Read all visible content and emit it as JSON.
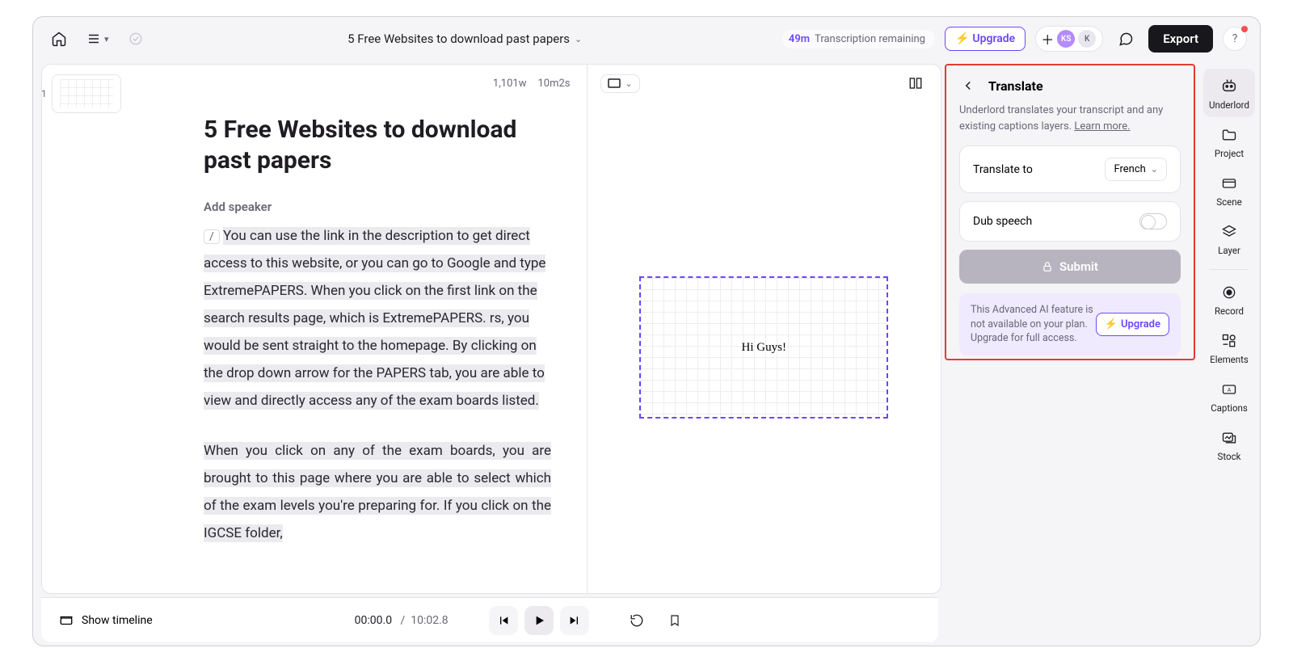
{
  "header": {
    "title": "5 Free Websites to download past papers",
    "transcription_time": "49m",
    "transcription_label": "Transcription remaining",
    "upgrade": "Upgrade",
    "export": "Export",
    "avatar1": "KS",
    "avatar2": "K"
  },
  "scenes": {
    "first_index": "1"
  },
  "meta": {
    "words": "1,101w",
    "duration": "10m2s"
  },
  "transcript": {
    "title": "5 Free Websites to download past papers",
    "speaker": "Add speaker",
    "p1": "You can use the link in the description to get direct access to this website, or you can go to Google and type ExtremePAPERS. When you click on the first link on the search results page, which is ExtremePAPERS. rs, you would be sent straight to the homepage. By clicking on the drop down arrow for the PAPERS tab, you are able to view and directly access any of the exam boards listed.",
    "p2": "When you click on any of the exam boards, you are brought to this page where you are able to select which of the exam levels you're preparing for. If you click on the IGCSE folder,"
  },
  "canvas": {
    "frame_text": "Hi Guys!"
  },
  "translate": {
    "title": "Translate",
    "desc_a": "Underlord translates your transcript and any existing captions layers. ",
    "learn_more": "Learn more.",
    "to_label": "Translate to",
    "language": "French",
    "dub_label": "Dub speech",
    "submit": "Submit",
    "notice": "This Advanced AI feature is not available on your plan. Upgrade for full access.",
    "upgrade": "Upgrade"
  },
  "rail": {
    "underlord": "Underlord",
    "project": "Project",
    "scene": "Scene",
    "layer": "Layer",
    "record": "Record",
    "elements": "Elements",
    "captions": "Captions",
    "stock": "Stock"
  },
  "bottom": {
    "show_timeline": "Show timeline",
    "current": "00:00.0",
    "total": "10:02.8"
  }
}
